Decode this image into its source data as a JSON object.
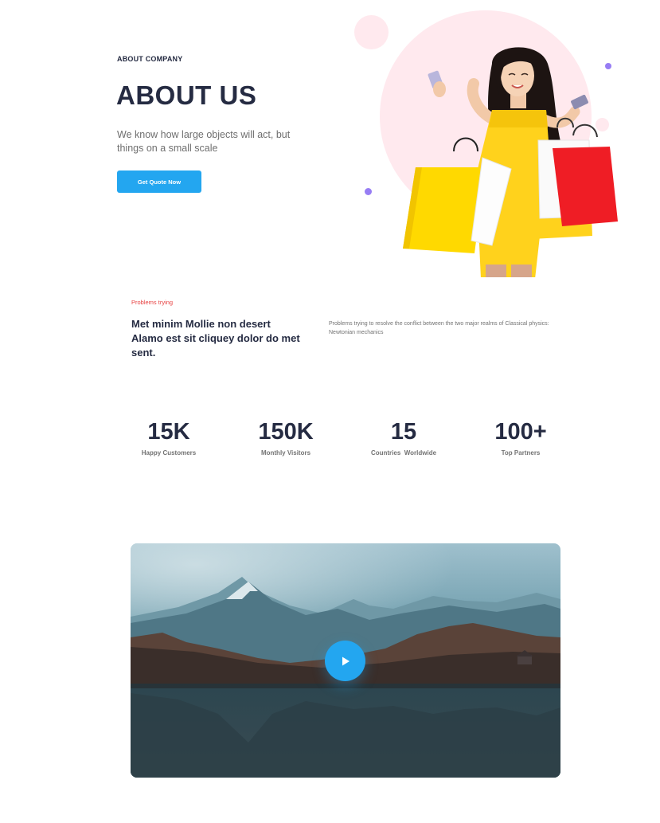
{
  "hero": {
    "eyebrow": "ABOUT COMPANY",
    "title": "ABOUT US",
    "description": "We know how large objects will act, but things on a small scale",
    "cta_label": "Get Quote Now"
  },
  "problems": {
    "label": "Problems trying",
    "heading": "Met minim Mollie non desert Alamo est sit cliquey dolor do met sent.",
    "text": "Problems trying to resolve the conflict between the two major realms of Classical physics: Newtonian mechanics"
  },
  "stats": [
    {
      "number": "15K",
      "label": "Happy Customers"
    },
    {
      "number": "150K",
      "label": "Monthly Visitors"
    },
    {
      "number": "15",
      "label": "Countries  Worldwide"
    },
    {
      "number": "100+",
      "label": "Top Partners"
    }
  ],
  "video": {
    "play_icon": "play-icon"
  },
  "colors": {
    "primary": "#23a6f0",
    "heading": "#252b42",
    "muted": "#737373",
    "danger": "#e74040",
    "pink": "#ffe9ee",
    "purple": "#977df4"
  }
}
